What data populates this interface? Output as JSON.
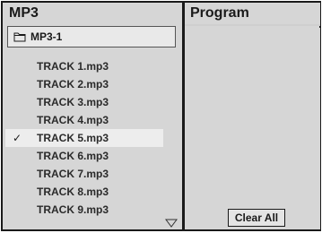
{
  "left_panel": {
    "title": "MP3",
    "folder": {
      "icon": "folder-icon",
      "label": "MP3-1"
    },
    "tracks": [
      {
        "label": "TRACK 1.mp3",
        "selected": false
      },
      {
        "label": "TRACK 2.mp3",
        "selected": false
      },
      {
        "label": "TRACK 3.mp3",
        "selected": false
      },
      {
        "label": "TRACK 4.mp3",
        "selected": false
      },
      {
        "label": "TRACK 5.mp3",
        "selected": true,
        "mark": "✓"
      },
      {
        "label": "TRACK 6.mp3",
        "selected": false
      },
      {
        "label": "TRACK 7.mp3",
        "selected": false
      },
      {
        "label": "TRACK 8.mp3",
        "selected": false
      },
      {
        "label": "TRACK 9.mp3",
        "selected": false
      }
    ],
    "scroll_icon": "triangle-down-icon"
  },
  "right_panel": {
    "title": "Program",
    "clear_button_label": "Clear All"
  },
  "colors": {
    "panel_bg": "#d6d6d6",
    "border": "#1a1a1a",
    "selected_row": "#ededed"
  }
}
